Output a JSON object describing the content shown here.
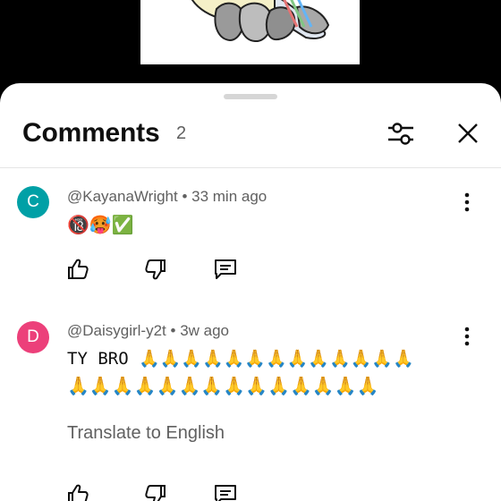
{
  "header": {
    "title": "Comments",
    "count": "2"
  },
  "comments": [
    {
      "avatar_letter": "C",
      "avatar_color": "#00a0a6",
      "author": "@KayanaWright",
      "separator": " • ",
      "time": "33 min ago",
      "text": "🔞🥵✅"
    },
    {
      "avatar_letter": "D",
      "avatar_color": "#ec407a",
      "author": "@Daisygirl-y2t",
      "separator": " • ",
      "time": "3w ago",
      "text_line1": "TY BRO 🙏🙏🙏🙏🙏🙏🙏🙏🙏🙏🙏🙏🙏",
      "text_line2": "🙏🙏🙏🙏🙏🙏🙏🙏🙏🙏🙏🙏🙏🙏",
      "translate_label": "Translate to English"
    }
  ],
  "icons": {
    "filter": "sliders-icon",
    "close": "close-icon",
    "more": "more-vertical-icon",
    "like": "thumb-up-icon",
    "dislike": "thumb-down-icon",
    "reply": "reply-icon"
  }
}
